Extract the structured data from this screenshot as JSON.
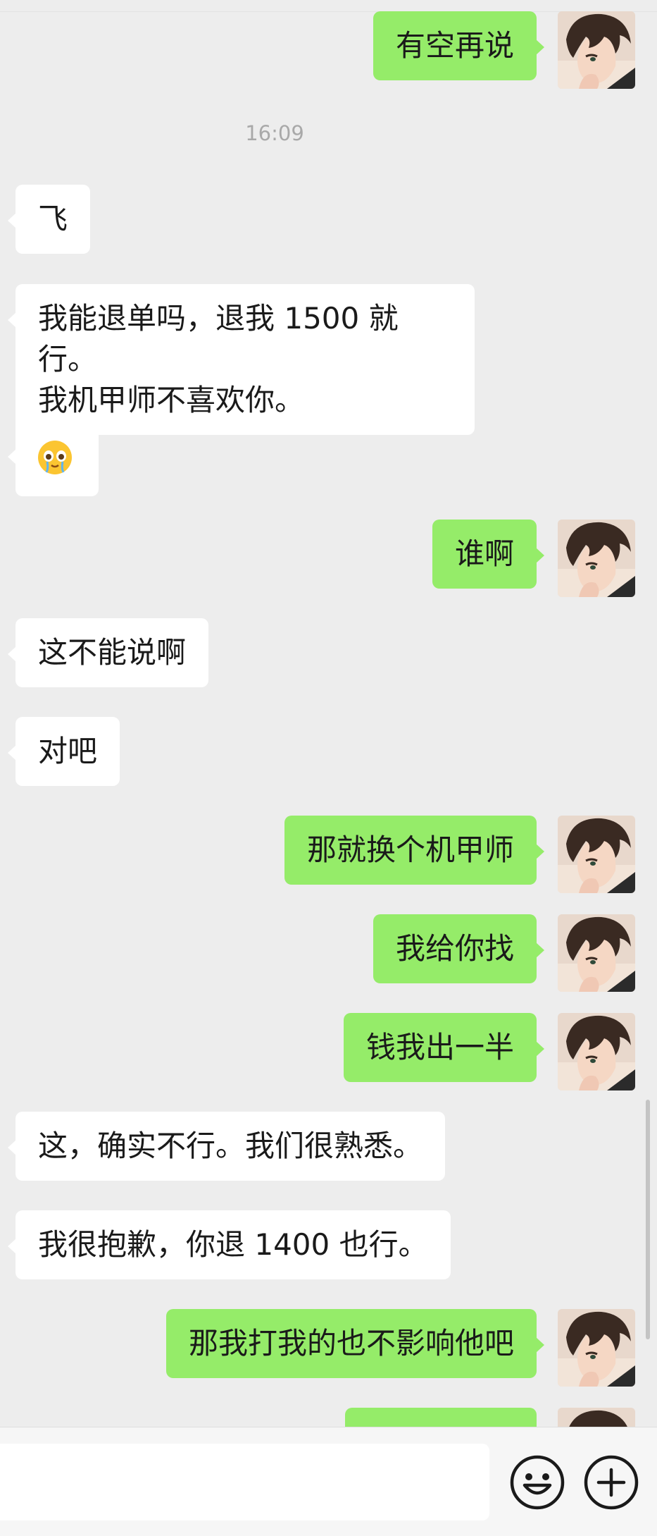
{
  "chat": {
    "timestamp": "16:09",
    "messages": [
      {
        "dir": "out",
        "text": "有空再说"
      },
      {
        "dir": "in",
        "text": "飞"
      },
      {
        "dir": "in",
        "text": "我能退单吗，退我 1500 就行。我机甲师不喜欢你。"
      },
      {
        "dir": "in",
        "emoji": "face-holding-back-tears-emoji"
      },
      {
        "dir": "out",
        "text": "谁啊"
      },
      {
        "dir": "in",
        "text": "这不能说啊"
      },
      {
        "dir": "in",
        "text": "对吧"
      },
      {
        "dir": "out",
        "text": "那就换个机甲师"
      },
      {
        "dir": "out",
        "text": "我给你找"
      },
      {
        "dir": "out",
        "text": "钱我出一半"
      },
      {
        "dir": "in",
        "text": "这，确实不行。我们很熟悉。"
      },
      {
        "dir": "in",
        "text": "我很抱歉，你退 1400 也行。"
      },
      {
        "dir": "out",
        "text": "那我打我的也不影响他吧"
      },
      {
        "dir": "out",
        "text": ""
      }
    ],
    "m2_line1": "我能退单吗，退我 1500 就行。",
    "m2_line2": "我机甲师不喜欢你。"
  },
  "input_bar": {
    "value": "",
    "emoji_button_icon": "smiley-icon",
    "more_button_icon": "plus-circle-icon"
  },
  "colors": {
    "background": "#ededed",
    "incoming_bubble": "#ffffff",
    "outgoing_bubble": "#95ec69",
    "timestamp": "#a9a9a9"
  }
}
